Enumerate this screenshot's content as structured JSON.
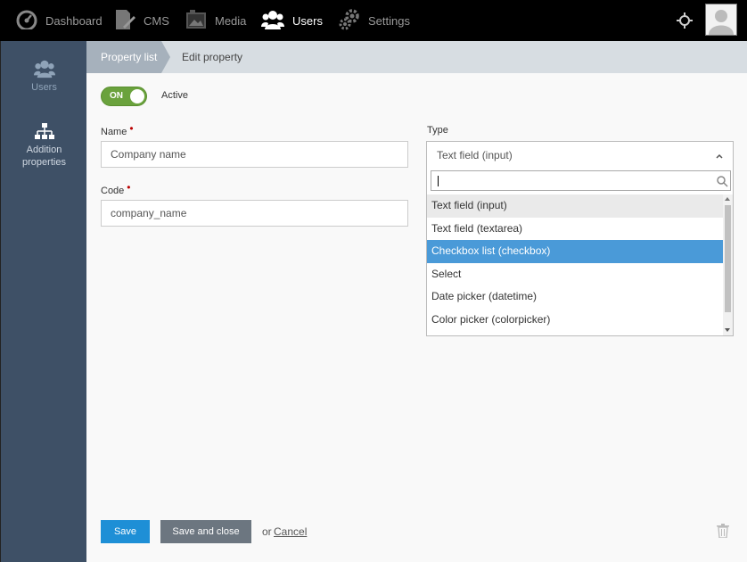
{
  "topnav": {
    "items": [
      {
        "label": "Dashboard",
        "icon": "speedometer-icon"
      },
      {
        "label": "CMS",
        "icon": "document-pen-icon"
      },
      {
        "label": "Media",
        "icon": "image-icon"
      },
      {
        "label": "Users",
        "icon": "users-icon",
        "active": true
      },
      {
        "label": "Settings",
        "icon": "gears-icon"
      }
    ]
  },
  "sidebar": {
    "items": [
      {
        "label": "Users",
        "icon": "users-icon",
        "active": true
      },
      {
        "label": "Addition properties",
        "icon": "hierarchy-icon"
      }
    ]
  },
  "breadcrumb": {
    "items": [
      "Property list",
      "Edit property"
    ]
  },
  "form": {
    "toggle_label": "ON",
    "active_label": "Active",
    "name_label": "Name",
    "name_value": "Company name",
    "code_label": "Code",
    "code_value": "company_name",
    "type_label": "Type",
    "type_value": "Text field (input)",
    "type_search_value": "",
    "type_options": [
      "Text field (input)",
      "Text field (textarea)",
      "Checkbox list (checkbox)",
      "Select",
      "Date picker (datetime)",
      "Color picker (colorpicker)"
    ],
    "type_hover_option": "Text field (input)",
    "type_selected_option": "Checkbox list (checkbox)"
  },
  "actions": {
    "save_label": "Save",
    "save_close_label": "Save and close",
    "or_label": "or",
    "cancel_label": "Cancel"
  },
  "colors": {
    "topbar": "#000000",
    "sidebar": "#3e5066",
    "toggle_on": "#6aa23d",
    "primary": "#1e8fd6",
    "selected_option": "#4a9ad8"
  }
}
